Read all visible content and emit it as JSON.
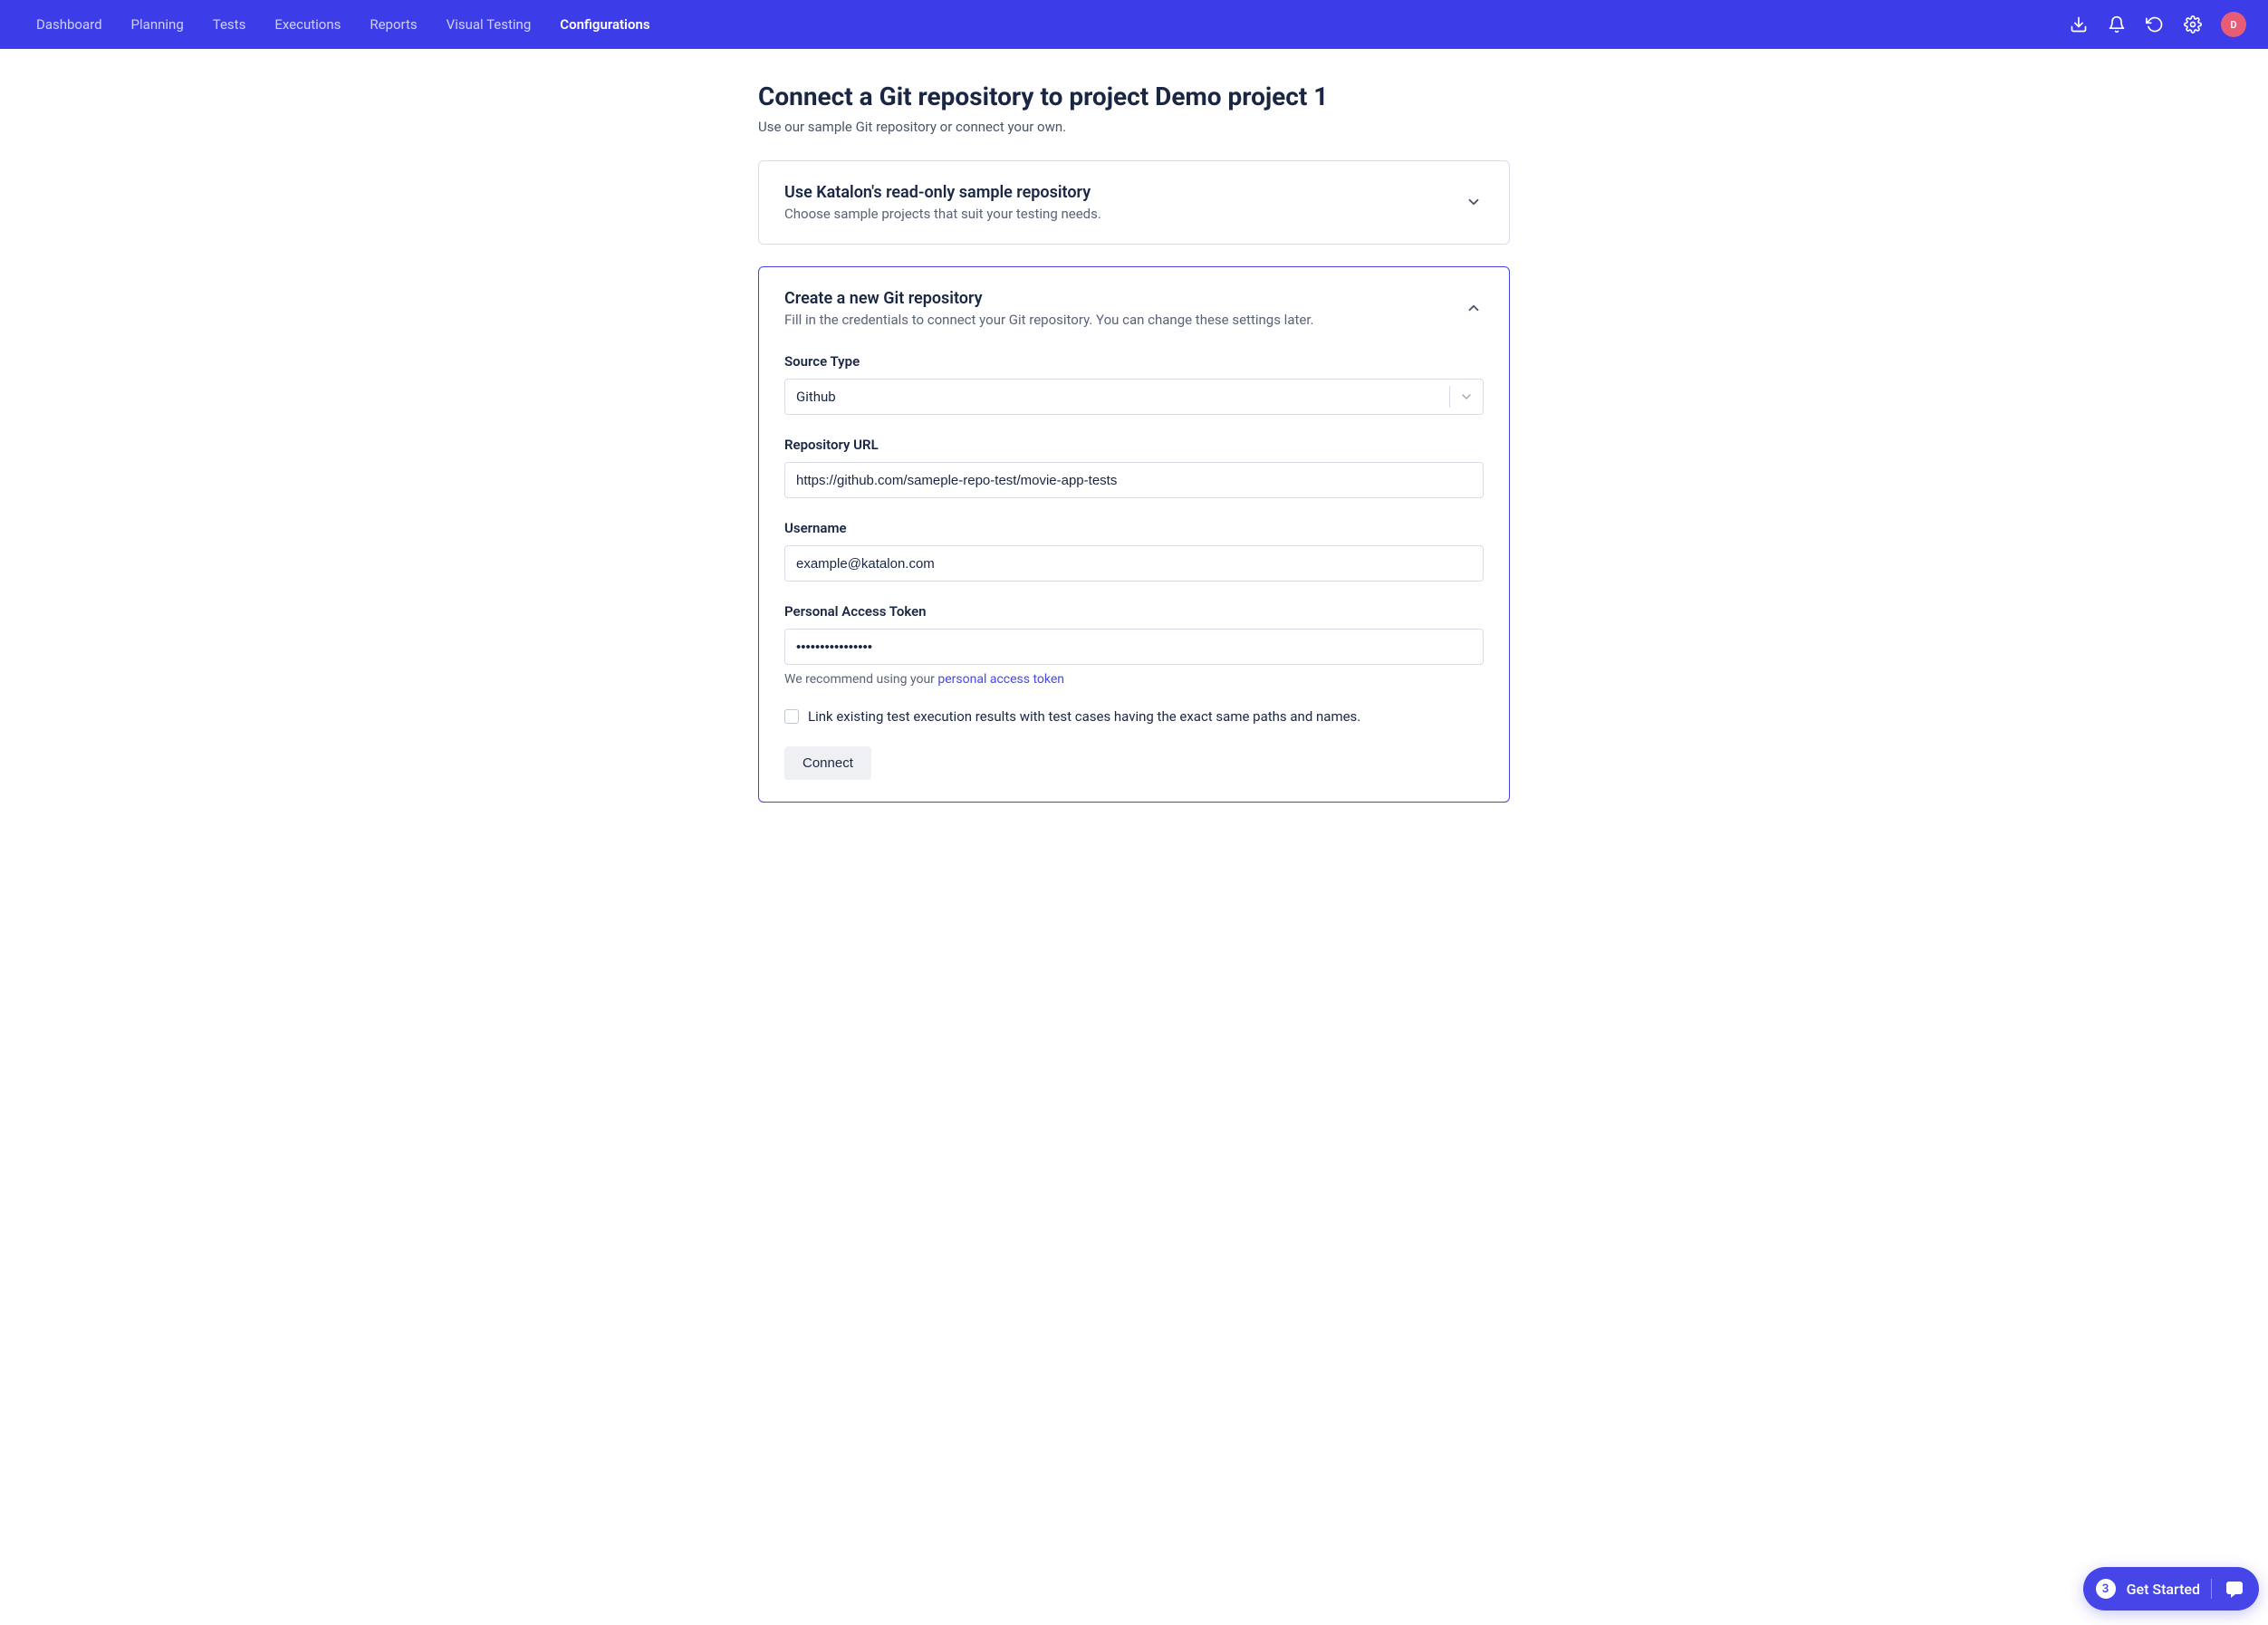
{
  "nav": {
    "items": [
      {
        "label": "Dashboard",
        "active": false
      },
      {
        "label": "Planning",
        "active": false
      },
      {
        "label": "Tests",
        "active": false
      },
      {
        "label": "Executions",
        "active": false
      },
      {
        "label": "Reports",
        "active": false
      },
      {
        "label": "Visual Testing",
        "active": false
      },
      {
        "label": "Configurations",
        "active": true
      }
    ],
    "avatar_initial": "D"
  },
  "page": {
    "title": "Connect a Git repository to project Demo project 1",
    "subtitle": "Use our sample Git repository or connect your own."
  },
  "card_sample": {
    "title": "Use Katalon's read-only sample repository",
    "subtitle": "Choose sample projects that suit your testing needs."
  },
  "card_new": {
    "title": "Create a new Git repository",
    "subtitle": "Fill in the credentials to connect your Git repository. You can change these settings later."
  },
  "form": {
    "source_type_label": "Source Type",
    "source_type_value": "Github",
    "repo_url_label": "Repository URL",
    "repo_url_value": "https://github.com/sameple-repo-test/movie-app-tests",
    "username_label": "Username",
    "username_value": "example@katalon.com",
    "token_label": "Personal Access Token",
    "token_value": "••••••••••••••••",
    "token_helper_prefix": "We recommend using your ",
    "token_helper_link": "personal access token",
    "checkbox_label": "Link existing test execution results with test cases having the exact same paths and names.",
    "connect_button": "Connect"
  },
  "widget": {
    "count": "3",
    "text": "Get Started"
  }
}
